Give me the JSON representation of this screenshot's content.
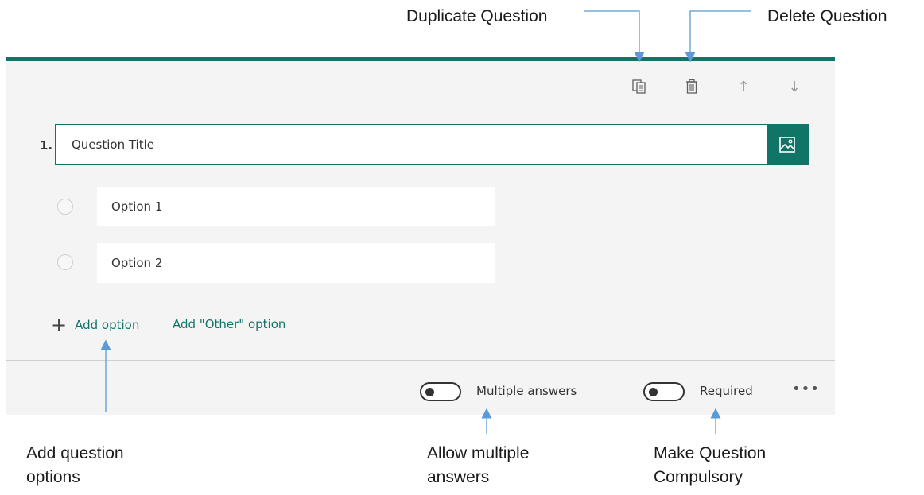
{
  "annotations": {
    "duplicate": "Duplicate Question",
    "delete": "Delete Question",
    "add_options_line1": "Add question",
    "add_options_line2": "options",
    "multiple_line1": "Allow multiple",
    "multiple_line2": "answers",
    "required_line1": "Make Question",
    "required_line2": "Compulsory"
  },
  "toolbar": {
    "icons": [
      "copy-icon",
      "trash-icon",
      "arrow-up-icon",
      "arrow-down-icon"
    ]
  },
  "question": {
    "number": "1.",
    "title": "Question Title"
  },
  "options": [
    {
      "label": "Option 1",
      "selected": false
    },
    {
      "label": "Option 2",
      "selected": false
    }
  ],
  "actions": {
    "add_option": "Add option",
    "add_other": "Add \"Other\" option"
  },
  "footer": {
    "multiple_answers_label": "Multiple answers",
    "multiple_answers_on": false,
    "required_label": "Required",
    "required_on": false,
    "more": "•••"
  },
  "colors": {
    "accent": "#107566",
    "annotation_arrow": "#5b9bd5",
    "card_bg": "#f4f4f4"
  }
}
